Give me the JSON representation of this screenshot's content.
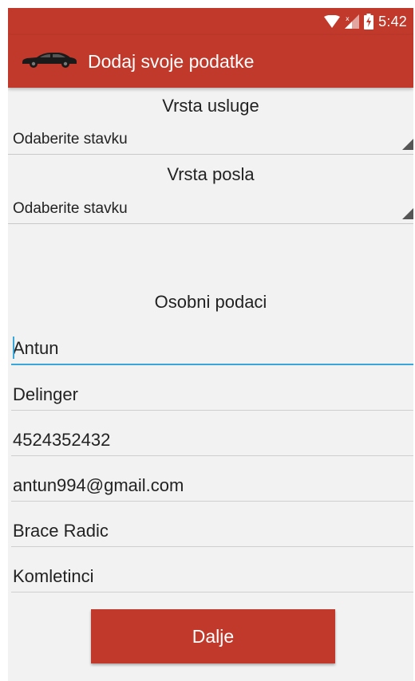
{
  "status_bar": {
    "time": "5:42",
    "icons": [
      "wifi-icon",
      "signal-icon",
      "battery-charging-icon"
    ]
  },
  "app_bar": {
    "icon": "car-icon",
    "title": "Dodaj svoje podatke"
  },
  "service_type": {
    "label": "Vrsta usluge",
    "selected": "Odaberite stavku"
  },
  "job_type": {
    "label": "Vrsta posla",
    "selected": "Odaberite stavku"
  },
  "personal": {
    "heading": "Osobni podaci",
    "fields": [
      {
        "value": "Antun"
      },
      {
        "value": "Delinger"
      },
      {
        "value": "4524352432"
      },
      {
        "value": "antun994@gmail.com"
      },
      {
        "value": "Brace Radic"
      },
      {
        "value": "Komletinci"
      }
    ]
  },
  "actions": {
    "next_label": "Dalje"
  },
  "colors": {
    "primary": "#c0392b",
    "focus": "#3aa6d9",
    "background": "#f2f2f2"
  }
}
